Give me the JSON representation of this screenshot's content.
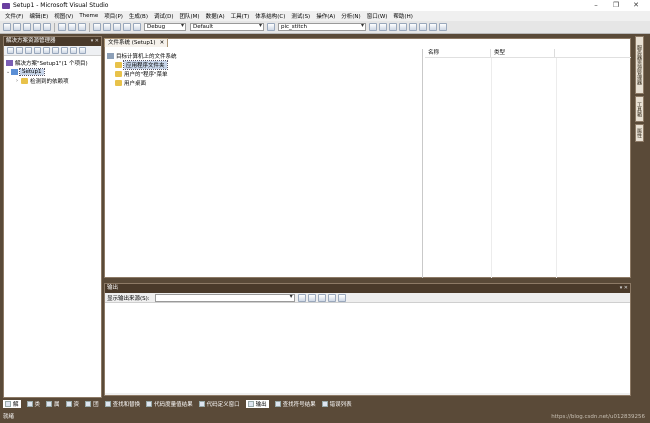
{
  "window": {
    "title": "Setup1 - Microsoft Visual Studio"
  },
  "menu": [
    "文件(F)",
    "编辑(E)",
    "视图(V)",
    "Theme",
    "项目(P)",
    "生成(B)",
    "调试(D)",
    "团队(M)",
    "数据(A)",
    "工具(T)",
    "体系结构(C)",
    "测试(S)",
    "操作(A)",
    "分析(N)",
    "窗口(W)",
    "帮助(H)"
  ],
  "toolbar": {
    "config": "Debug",
    "platform": "Default",
    "startup": "pic_stitch"
  },
  "solution_explorer": {
    "title": "解决方案资源管理器",
    "solution": "解决方案\"Setup1\"(1 个项目)",
    "project": "Setup1",
    "child": "检测到的依赖项"
  },
  "file_system": {
    "tab": "文件系统 (Setup1)",
    "root": "目标计算机上的文件系统",
    "items": [
      "应用程序文件夹",
      "用户的\"程序\"菜单",
      "用户桌面"
    ],
    "col_name": "名称",
    "col_type": "类型"
  },
  "output": {
    "title": "输出",
    "source_label": "显示输出来源(S):"
  },
  "right_tabs": [
    "服务器资源管理器",
    "工具箱",
    "属性"
  ],
  "bottom_tabs": [
    "解",
    "类",
    "属",
    "资",
    "团",
    "查找和替换",
    "代码度量值结果",
    "代码定义窗口",
    "输出",
    "查找符号结果",
    "错误列表"
  ],
  "status": {
    "text": "就绪",
    "watermark": "https://blog.csdn.net/u012839256"
  }
}
